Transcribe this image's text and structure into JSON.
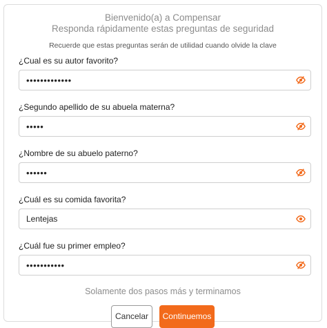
{
  "header": {
    "welcome": "Bienvenido(a) a Compensar",
    "subtitle": "Responda rápidamente estas preguntas de seguridad",
    "hint": "Recuerde que estas preguntas serán de utilidad cuando olvide la clave"
  },
  "questions": [
    {
      "label": "¿Cual es su autor favorito?",
      "value": "•••••••••••••",
      "masked": true,
      "icon": "eye-slash-icon"
    },
    {
      "label": "¿Segundo apellido de su abuela materna?",
      "value": "•••••",
      "masked": true,
      "icon": "eye-slash-icon"
    },
    {
      "label": "¿Nombre de su abuelo paterno?",
      "value": "••••••",
      "masked": true,
      "icon": "eye-slash-icon"
    },
    {
      "label": "¿Cuál es su comida favorita?",
      "value": "Lentejas",
      "masked": false,
      "icon": "eye-icon"
    },
    {
      "label": "¿Cuál fue su primer empleo?",
      "value": "•••••••••••",
      "masked": true,
      "icon": "eye-slash-icon"
    }
  ],
  "footer": {
    "progress_text": "Solamente dos pasos más y terminamos",
    "cancel_label": "Cancelar",
    "continue_label": "Continuemos"
  },
  "colors": {
    "accent": "#f26a1b",
    "muted_text": "#8c8c8c",
    "border": "#cfcfcf"
  }
}
